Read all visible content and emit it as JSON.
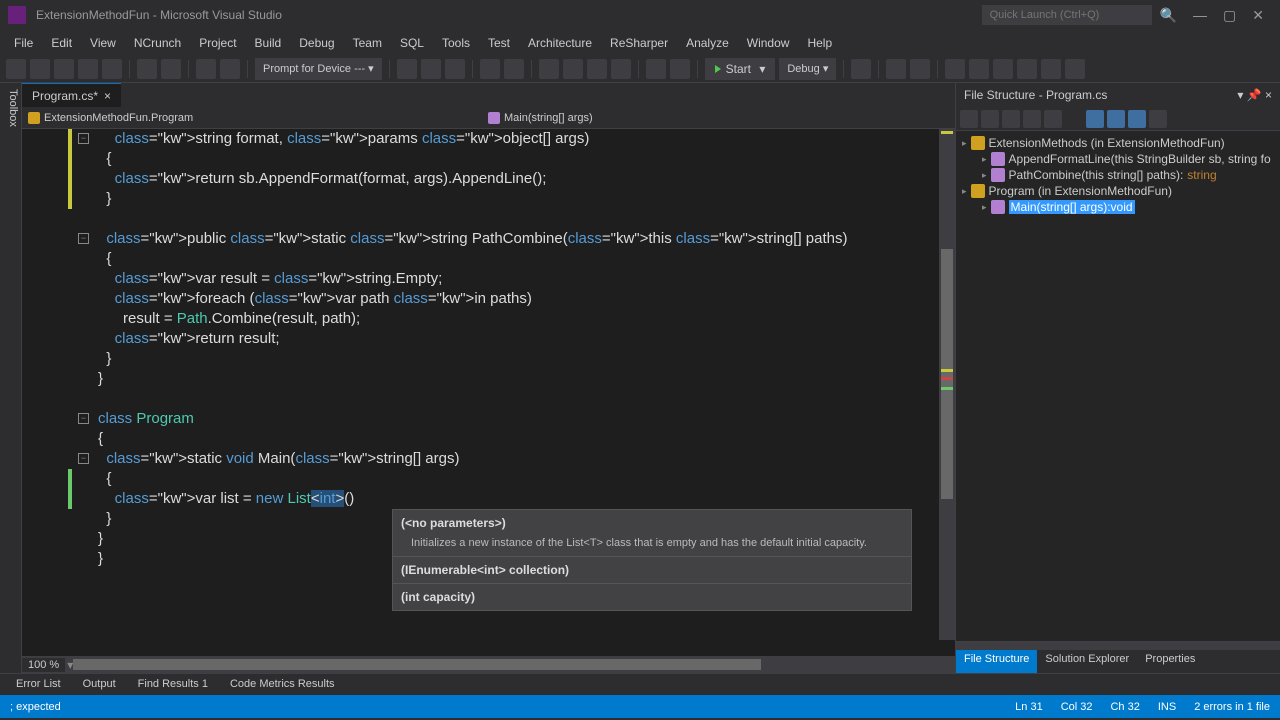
{
  "window": {
    "title": "ExtensionMethodFun - Microsoft Visual Studio",
    "quicklaunch_placeholder": "Quick Launch (Ctrl+Q)"
  },
  "menu": [
    "File",
    "Edit",
    "View",
    "NCrunch",
    "Project",
    "Build",
    "Debug",
    "Team",
    "SQL",
    "Tools",
    "Test",
    "Architecture",
    "ReSharper",
    "Analyze",
    "Window",
    "Help"
  ],
  "toolbar": {
    "prompt": "Prompt for Device ---",
    "start": "Start",
    "config": "Debug"
  },
  "toolbox_tab": "Toolbox",
  "tab": {
    "name": "Program.cs*",
    "unsaved": true
  },
  "navbar": {
    "left": "ExtensionMethodFun.Program",
    "right": "Main(string[] args)"
  },
  "code_lines": [
    "    string format, params object[] args)",
    "  {",
    "    return sb.AppendFormat(format, args).AppendLine();",
    "  }",
    "",
    "  public static string PathCombine(this string[] paths)",
    "  {",
    "    var result = string.Empty;",
    "    foreach (var path in paths)",
    "      result = Path.Combine(result, path);",
    "    return result;",
    "  }",
    "}",
    "",
    "class Program",
    "{",
    "  static void Main(string[] args)",
    "  {",
    "    var list = new List<int>()",
    "  }",
    "}",
    "}"
  ],
  "intellisense": {
    "sig1": "(<no parameters>)",
    "desc": "Initializes a new instance of the List<T> class that is empty and has the default initial capacity.",
    "sig2": "(IEnumerable<int> collection)",
    "sig3": "(int capacity)"
  },
  "zoom": "100 %",
  "file_structure": {
    "title": "File Structure - Program.cs",
    "nodes": [
      {
        "indent": 0,
        "icon": "cls",
        "text": "ExtensionMethods (in ExtensionMethodFun)"
      },
      {
        "indent": 1,
        "icon": "mth",
        "text": "AppendFormatLine(this StringBuilder sb, string fo"
      },
      {
        "indent": 1,
        "icon": "mth",
        "text": "PathCombine(this string[] paths):",
        "ret": "string"
      },
      {
        "indent": 0,
        "icon": "cls",
        "text": "Program (in ExtensionMethodFun)"
      },
      {
        "indent": 1,
        "icon": "mth",
        "text": "Main(string[] args):void",
        "selected": true
      }
    ]
  },
  "right_tabs": [
    "File Structure",
    "Solution Explorer",
    "Properties"
  ],
  "bottom_tabs": [
    "Error List",
    "Output",
    "Find Results 1",
    "Code Metrics Results"
  ],
  "status": {
    "msg": "; expected",
    "ln": "Ln 31",
    "col": "Col 32",
    "ch": "Ch 32",
    "ins": "INS",
    "errors": "2 errors in 1 file"
  }
}
